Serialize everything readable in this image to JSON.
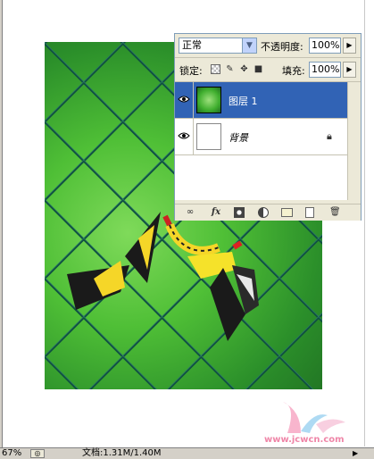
{
  "layers_panel": {
    "blend_mode": "正常",
    "opacity_label": "不透明度:",
    "opacity_value": "100%",
    "lock_label": "锁定:",
    "fill_label": "填充:",
    "fill_value": "100%",
    "layers": [
      {
        "name": "图层 1",
        "selected": true,
        "visible": true,
        "thumbnail": "butterfly-photo"
      },
      {
        "name": "背景",
        "selected": false,
        "visible": true,
        "locked": true,
        "thumbnail": "white"
      }
    ],
    "bottom_icons": [
      "link-icon",
      "fx-icon",
      "layer-mask-icon",
      "adjustment-layer-icon",
      "new-group-icon",
      "new-layer-icon",
      "trash-icon"
    ]
  },
  "status_bar": {
    "zoom": "67%",
    "doc_info": "文档:1.31M/1.40M"
  },
  "watermark": {
    "text": "www.jcwcn.com"
  },
  "colors": {
    "selection": "#3163b5",
    "panel_bg": "#ece9d8",
    "canvas_green": "#4fbf36",
    "fence": "#0f4f3f"
  }
}
